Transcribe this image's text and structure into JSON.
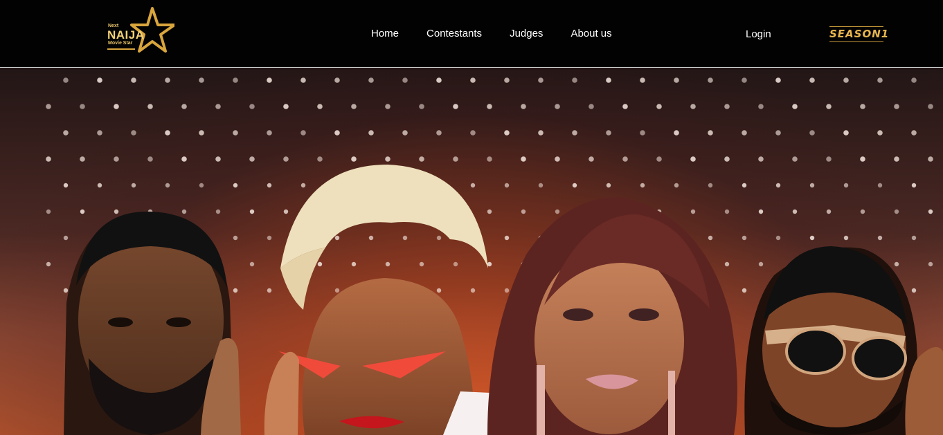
{
  "brand": {
    "logo_small": "Next",
    "logo_main": "NAIJA",
    "logo_sub": "Movie Star",
    "gold": "#e7b54f"
  },
  "nav": {
    "items": [
      {
        "label": "Home"
      },
      {
        "label": "Contestants"
      },
      {
        "label": "Judges"
      },
      {
        "label": "About us"
      }
    ],
    "login": "Login",
    "season_badge": "SEASON1"
  },
  "hero": {
    "people": [
      {
        "name": "judge-man-left"
      },
      {
        "name": "judge-woman-blonde"
      },
      {
        "name": "judge-woman-auburn"
      },
      {
        "name": "judge-man-sunglasses"
      }
    ]
  }
}
